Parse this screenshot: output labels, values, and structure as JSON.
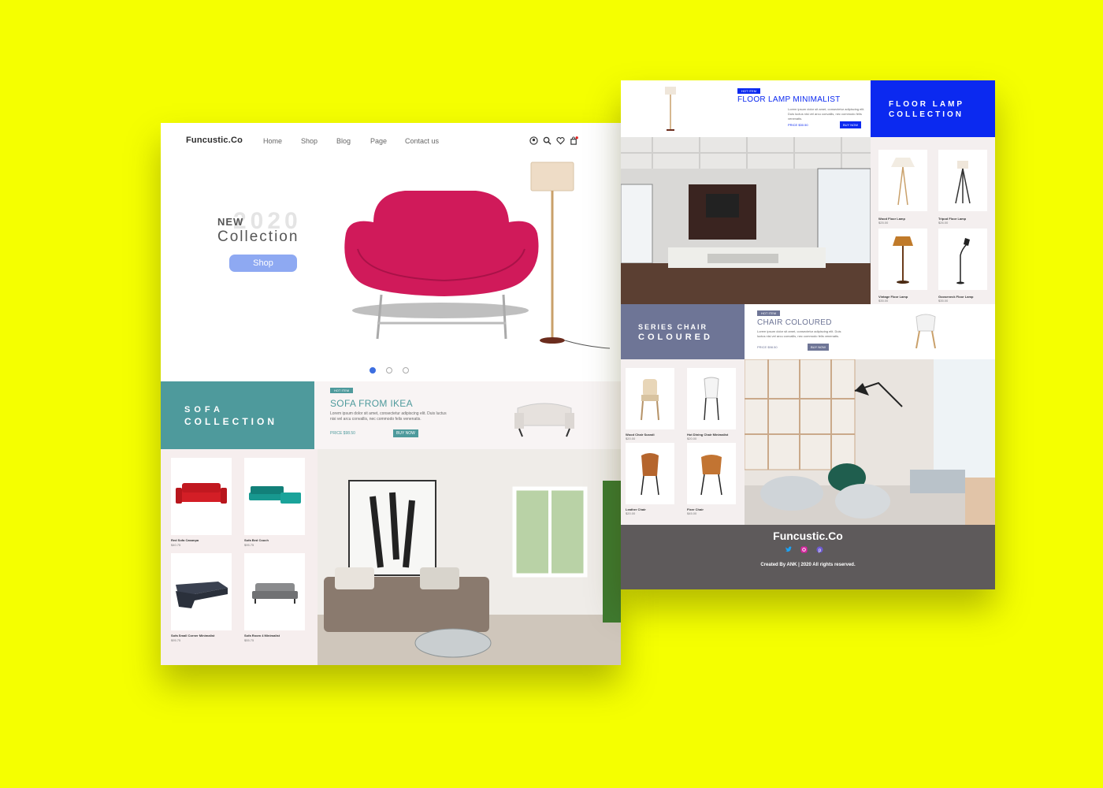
{
  "colors": {
    "background": "#f5ff00",
    "teal": "#4e9a9c",
    "blue": "#0b29f0",
    "slate": "#6e7596",
    "footer": "#5e5a5b",
    "shop_button": "#8ea9f2",
    "sofa_red": "#d01a5a"
  },
  "left_page": {
    "brand": "Funcustic.Co",
    "nav": [
      "Home",
      "Shop",
      "Blog",
      "Page",
      "Contact us"
    ],
    "nav_icons": [
      "user-icon",
      "search-icon",
      "heart-icon",
      "cart-icon"
    ],
    "hero": {
      "new": "NEW",
      "year": "2020",
      "collection": "Collection",
      "shop_button": "Shop"
    },
    "carousel_dots": 3,
    "sofa_collection": {
      "line1": "SOFA",
      "line2": "COLLECTION"
    },
    "promo": {
      "tag": "HOT ITEM",
      "title": "SOFA FROM IKEA",
      "desc": "Lorem ipsum dolor sit amet, consectetur adipiscing elit. Duis luctus nisi vel arcu convallis, nec commodo felis venenatis.",
      "price": "PRICE $98.50",
      "buy": "BUY NOW"
    },
    "products": [
      {
        "name": "Red Sofa Casanpa",
        "price": "$40.75"
      },
      {
        "name": "Sofa Bed Couch",
        "price": "$95.75"
      },
      {
        "name": "Sofa Small Corner Minimalist",
        "price": "$95.75"
      },
      {
        "name": "Sofa Room 4 Minimalist",
        "price": "$55.75"
      }
    ]
  },
  "right_page": {
    "floor_lamp_promo": {
      "tag": "HOT ITEM",
      "title": "FLOOR LAMP MINIMALIST",
      "desc": "Lorem ipsum dolor sit amet, consectetur adipiscing elit. Duis luctus nisi vel arcu convallis, nec commodo felis venenatis.",
      "price": "PRICE $30.50",
      "buy": "BUY NOW"
    },
    "floor_lamp_collection": {
      "line1": "FLOOR LAMP",
      "line2": "COLLECTION"
    },
    "lamps": [
      {
        "name": "Wood Floor Lamp",
        "price": "$25.00"
      },
      {
        "name": "Tripod Floor Lamp",
        "price": "$26.00"
      },
      {
        "name": "Vintage Floor Lamp",
        "price": "$35.00"
      },
      {
        "name": "Gooseneck Floor Lamp",
        "price": "$35.00"
      }
    ],
    "series_chair": {
      "line1": "SERIES CHAIR",
      "line2": "COLOURED"
    },
    "chair_promo": {
      "tag": "HOT ITEM",
      "title": "CHAIR COLOURED",
      "desc": "Lorem ipsum dolor sit amet, consectetur adipiscing elit. Duis luctus nisi vel arcu convallis, nec commodo felis venenatis.",
      "price": "PRICE $98.50",
      "buy": "BUY NOW"
    },
    "chairs": [
      {
        "name": "Wood Chair Scandi",
        "price": "$20.00"
      },
      {
        "name": "Hot Dining Chair Minimalist",
        "price": "$20.00"
      },
      {
        "name": "Leather Chair",
        "price": "$20.00"
      },
      {
        "name": "Fixer Chair",
        "price": "$45.00"
      }
    ],
    "footer": {
      "brand": "Funcustic.Co",
      "socials": [
        "twitter-icon",
        "instagram-icon",
        "pinterest-icon"
      ],
      "copyright": "Created By ANK | 2020 All rights reserved."
    }
  }
}
